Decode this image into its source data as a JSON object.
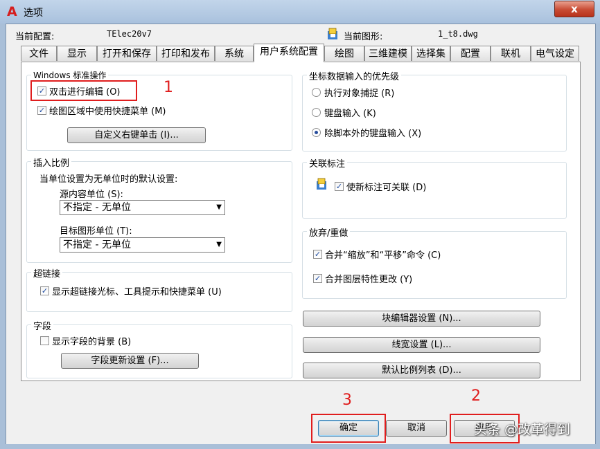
{
  "window": {
    "title": "选项",
    "app_icon": "A",
    "close_glyph": "x"
  },
  "profile": {
    "current_profile_label": "当前配置:",
    "current_profile_value": "TElec20v7",
    "current_drawing_label": "当前图形:",
    "current_drawing_value": "1_t8.dwg"
  },
  "tabs": [
    {
      "label": "文件"
    },
    {
      "label": "显示"
    },
    {
      "label": "打开和保存"
    },
    {
      "label": "打印和发布"
    },
    {
      "label": "系统"
    },
    {
      "label": "用户系统配置",
      "active": true
    },
    {
      "label": "绘图"
    },
    {
      "label": "三维建模"
    },
    {
      "label": "选择集"
    },
    {
      "label": "配置"
    },
    {
      "label": "联机"
    },
    {
      "label": "电气设定"
    }
  ],
  "windows_ops": {
    "title": "Windows 标准操作",
    "double_click_edit": {
      "label": "双击进行编辑 (O)",
      "checked": true
    },
    "shortcut_menus": {
      "label": "绘图区域中使用快捷菜单 (M)",
      "checked": true
    },
    "right_click_button": "自定义右键单击 (I)..."
  },
  "insert_scale": {
    "title": "插入比例",
    "note": "当单位设置为无单位时的默认设置:",
    "source_label": "源内容单位 (S):",
    "source_value": "不指定 - 无单位",
    "target_label": "目标图形单位 (T):",
    "target_value": "不指定 - 无单位"
  },
  "hyperlink": {
    "title": "超链接",
    "show_cursor": {
      "label": "显示超链接光标、工具提示和快捷菜单 (U)",
      "checked": true
    }
  },
  "fields": {
    "title": "字段",
    "show_background": {
      "label": "显示字段的背景 (B)",
      "checked": false
    },
    "update_button": "字段更新设置 (F)..."
  },
  "coord_priority": {
    "title": "坐标数据输入的优先级",
    "options": [
      {
        "label": "执行对象捕捉 (R)",
        "selected": false
      },
      {
        "label": "键盘输入 (K)",
        "selected": false
      },
      {
        "label": "除脚本外的键盘输入 (X)",
        "selected": true
      }
    ]
  },
  "assoc_dim": {
    "title": "关联标注",
    "make_assoc": {
      "label": "使新标注可关联 (D)",
      "checked": true
    }
  },
  "undo_redo": {
    "title": "放弃/重做",
    "combine_zoom_pan": {
      "label": "合并“缩放”和“平移”命令 (C)",
      "checked": true
    },
    "combine_layer": {
      "label": "合并图层特性更改 (Y)",
      "checked": true
    }
  },
  "side_buttons": {
    "block_editor": "块编辑器设置 (N)...",
    "lineweight": "线宽设置 (L)...",
    "scale_list": "默认比例列表 (D)..."
  },
  "dialog_buttons": {
    "ok": "确定",
    "cancel": "取消",
    "apply": "应用"
  },
  "annotations": {
    "num1": "1",
    "num2": "2",
    "num3": "3"
  },
  "watermark": "头条 @改革得到",
  "colors": {
    "annotation_red": "#e01d1d",
    "checkmark_blue": "#1c4aa2"
  }
}
